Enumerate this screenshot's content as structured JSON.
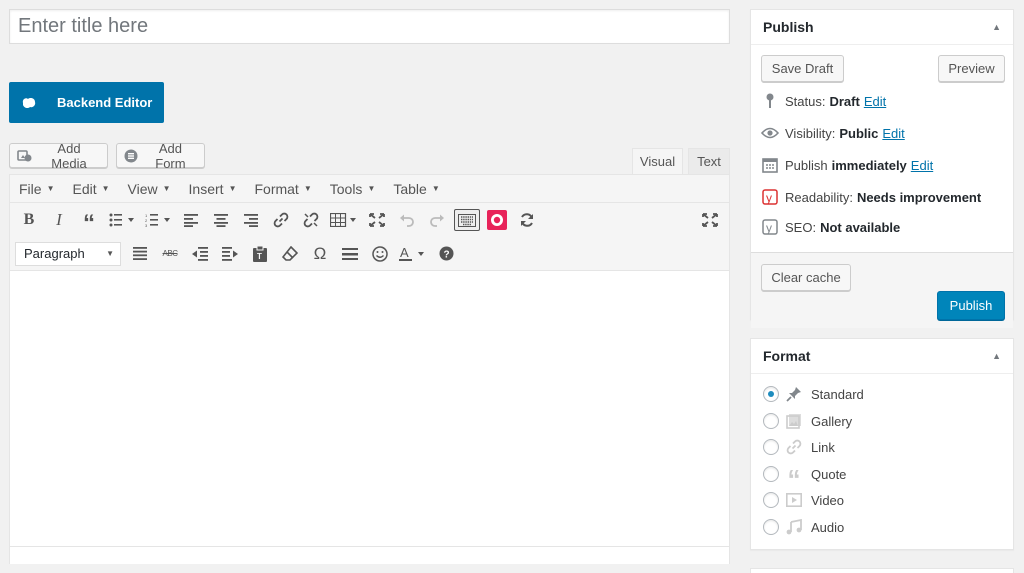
{
  "title": {
    "placeholder": "Enter title here",
    "value": ""
  },
  "builder": {
    "backend_label": "Backend Editor"
  },
  "media": {
    "add_media_label": "Add Media",
    "add_form_label": "Add Form"
  },
  "tabs": {
    "visual": "Visual",
    "text": "Text",
    "active": "visual"
  },
  "menubar": [
    {
      "label": "File"
    },
    {
      "label": "Edit"
    },
    {
      "label": "View"
    },
    {
      "label": "Insert"
    },
    {
      "label": "Format"
    },
    {
      "label": "Tools"
    },
    {
      "label": "Table"
    }
  ],
  "toolbar1": [
    "bold",
    "italic",
    "blockquote",
    "bullet-list",
    "numbered-list",
    "align-left",
    "align-center",
    "align-right",
    "insert-link",
    "remove-link",
    "table",
    "fullscreen",
    "undo",
    "redo",
    "toolbar-toggle",
    "record",
    "refresh",
    "distraction-free"
  ],
  "toolbar2": {
    "format_select": "Paragraph",
    "icons": [
      "justify",
      "strikethrough",
      "outdent",
      "indent",
      "paste-text",
      "clear-formatting",
      "special-character",
      "horizontal-line",
      "emoticons",
      "text-color",
      "help"
    ]
  },
  "publish": {
    "title": "Publish",
    "save_draft": "Save Draft",
    "preview": "Preview",
    "status_label": "Status:",
    "status_value": "Draft",
    "visibility_label": "Visibility:",
    "visibility_value": "Public",
    "publish_label": "Publish",
    "publish_value": "immediately",
    "edit": "Edit",
    "readability_label": "Readability:",
    "readability_value": "Needs improvement",
    "seo_label": "SEO:",
    "seo_value": "Not available",
    "clear_cache": "Clear cache",
    "publish_button": "Publish",
    "readability_color": "#dc3232"
  },
  "format": {
    "title": "Format",
    "selected": "Standard",
    "options": [
      {
        "label": "Standard",
        "icon": "pin-icon"
      },
      {
        "label": "Gallery",
        "icon": "gallery-icon"
      },
      {
        "label": "Link",
        "icon": "link-icon"
      },
      {
        "label": "Quote",
        "icon": "quote-icon"
      },
      {
        "label": "Video",
        "icon": "video-icon"
      },
      {
        "label": "Audio",
        "icon": "audio-icon"
      }
    ]
  },
  "colors": {
    "primary": "#0073aa",
    "publish": "#0085ba",
    "background": "#f1f1f1"
  }
}
